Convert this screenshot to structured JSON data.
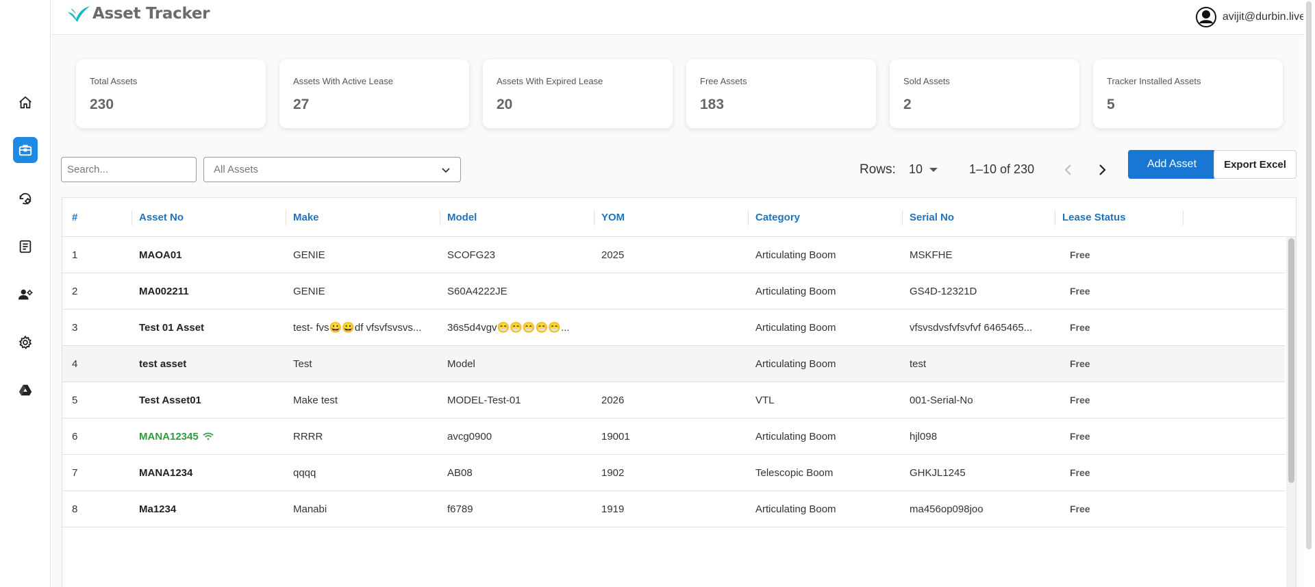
{
  "app": {
    "title": "Asset Tracker"
  },
  "user": {
    "email": "avijit@durbin.live"
  },
  "sidebar": {
    "items": [
      {
        "name": "home",
        "icon": "home-icon",
        "active": false
      },
      {
        "name": "assets",
        "icon": "briefcase-icon",
        "active": true
      },
      {
        "name": "maintenance",
        "icon": "history-gear-icon",
        "active": false
      },
      {
        "name": "documents",
        "icon": "document-icon",
        "active": false
      },
      {
        "name": "users",
        "icon": "users-settings-icon",
        "active": false
      },
      {
        "name": "settings",
        "icon": "gear-icon",
        "active": false
      },
      {
        "name": "drive",
        "icon": "drive-icon",
        "active": false
      }
    ]
  },
  "stats": [
    {
      "label": "Total Assets",
      "value": "230"
    },
    {
      "label": "Assets With Active Lease",
      "value": "27"
    },
    {
      "label": "Assets With Expired Lease",
      "value": "20"
    },
    {
      "label": "Free Assets",
      "value": "183"
    },
    {
      "label": "Sold Assets",
      "value": "2"
    },
    {
      "label": "Tracker Installed Assets",
      "value": "5"
    }
  ],
  "toolbar": {
    "search_placeholder": "Search...",
    "filter_value": "All Assets",
    "rows_label": "Rows:",
    "rows_value": "10",
    "page_range": "1–10 of 230",
    "add_label": "Add Asset",
    "export_label": "Export Excel"
  },
  "table": {
    "columns": [
      "#",
      "Asset No",
      "Make",
      "Model",
      "YOM",
      "Category",
      "Serial No",
      "Lease Status"
    ],
    "rows": [
      {
        "num": "1",
        "asset_no": "MAOA01",
        "make": "GENIE",
        "model": "SCOFG23",
        "yom": "2025",
        "category": "Articulating Boom",
        "serial": "MSKFHE",
        "status": "Free",
        "tracker": false
      },
      {
        "num": "2",
        "asset_no": "MA002211",
        "make": "GENIE",
        "model": "S60A4222JE",
        "yom": "",
        "category": "Articulating Boom",
        "serial": "GS4D-12321D",
        "status": "Free",
        "tracker": false
      },
      {
        "num": "3",
        "asset_no": "Test 01 Asset",
        "make": "test- fvs😀😀df vfsvfsvsvs...",
        "model": "36s5d4vgv😁😁😁😁😁...",
        "yom": "",
        "category": "Articulating Boom",
        "serial": "vfsvsdvsfvfsvfvf 6465465...",
        "status": "Free",
        "tracker": false
      },
      {
        "num": "4",
        "asset_no": "test asset",
        "make": "Test",
        "model": "Model",
        "yom": "",
        "category": "Articulating Boom",
        "serial": "test",
        "status": "Free",
        "tracker": false
      },
      {
        "num": "5",
        "asset_no": "Test Asset01",
        "make": "Make test",
        "model": "MODEL-Test-01",
        "yom": "2026",
        "category": "VTL",
        "serial": "001-Serial-No",
        "status": "Free",
        "tracker": false
      },
      {
        "num": "6",
        "asset_no": "MANA12345",
        "make": "RRRR",
        "model": "avcg0900",
        "yom": "19001",
        "category": "Articulating Boom",
        "serial": "hjl098",
        "status": "Free",
        "tracker": true
      },
      {
        "num": "7",
        "asset_no": "MANA1234",
        "make": "qqqq",
        "model": "AB08",
        "yom": "1902",
        "category": "Telescopic Boom",
        "serial": "GHKJL1245",
        "status": "Free",
        "tracker": false
      },
      {
        "num": "8",
        "asset_no": "Ma1234",
        "make": "Manabi",
        "model": "f6789",
        "yom": "1919",
        "category": "Articulating Boom",
        "serial": "ma456op098joo",
        "status": "Free",
        "tracker": false
      }
    ]
  },
  "colors": {
    "accent": "#1976d2",
    "header_text": "#1e73be",
    "tracker_green": "#2e9b3e",
    "logo": "#1ab7c4"
  }
}
